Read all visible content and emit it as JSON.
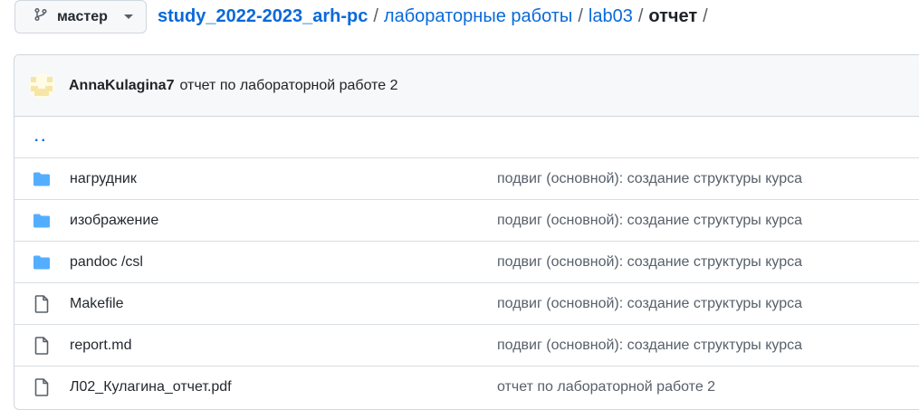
{
  "branch": {
    "label": "мастер",
    "icon": "git-branch-icon"
  },
  "breadcrumb": {
    "repo": "study_2022-2023_arh-pc",
    "path": [
      "лабораторные работы",
      "lab03"
    ],
    "current": "отчет",
    "separator": "/"
  },
  "commit": {
    "author": "AnnaKulagina7",
    "message": "отчет по лабораторной работе 2"
  },
  "parent_dir": "..",
  "files": [
    {
      "name": "нагрудник",
      "type": "folder",
      "icon": "folder-icon",
      "message": "подвиг (основной): создание структуры курса"
    },
    {
      "name": "изображение",
      "type": "folder",
      "icon": "folder-icon",
      "message": "подвиг (основной): создание структуры курса"
    },
    {
      "name": "pandoc /csl",
      "type": "folder",
      "icon": "folder-icon",
      "message": "подвиг (основной): создание структуры курса"
    },
    {
      "name": "Makefile",
      "type": "file",
      "icon": "file-icon",
      "message": "подвиг (основной): создание структуры курса"
    },
    {
      "name": "report.md",
      "type": "file",
      "icon": "file-icon",
      "message": "подвиг (основной): создание структуры курса"
    },
    {
      "name": "Л02_Кулагина_отчет.pdf",
      "type": "file",
      "icon": "file-icon",
      "message": "отчет по лабораторной работе 2"
    }
  ],
  "colors": {
    "link": "#0969da",
    "folder": "#54aeff",
    "muted": "#57606a",
    "border": "#d0d7de"
  }
}
